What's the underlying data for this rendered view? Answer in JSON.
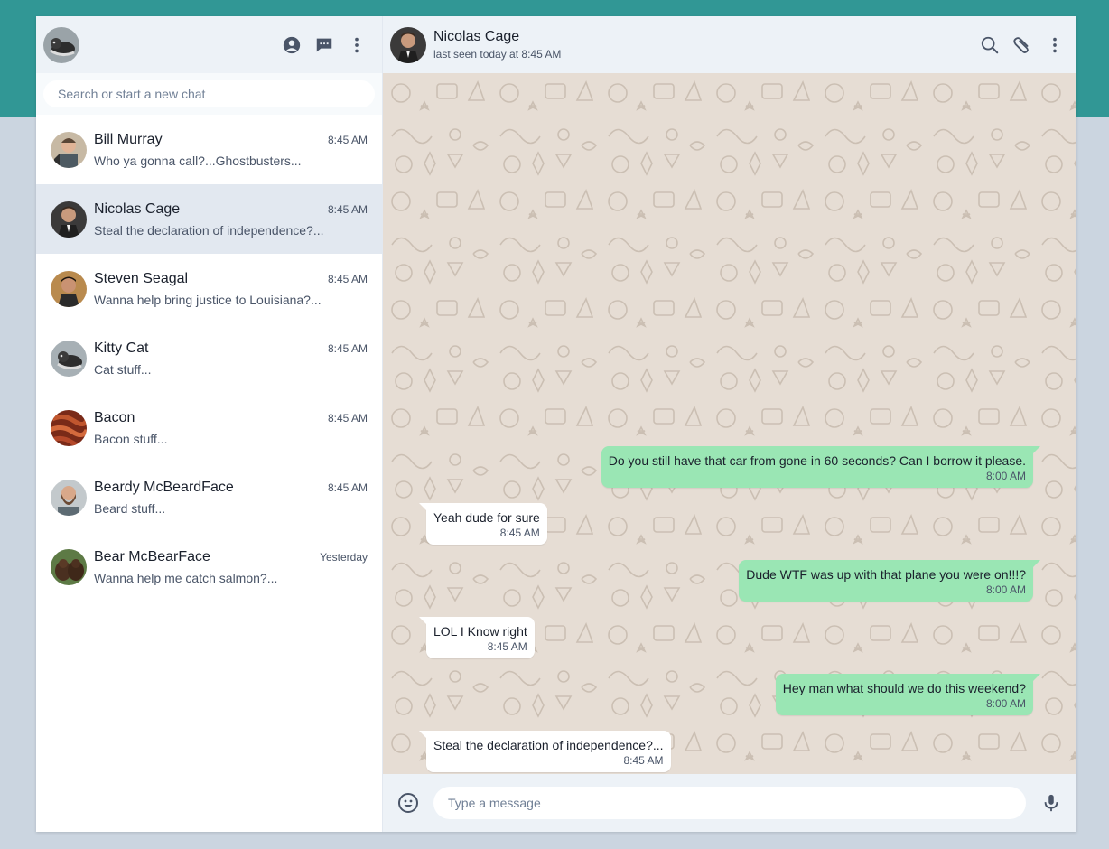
{
  "sidebar": {
    "search_placeholder": "Search or start a new chat",
    "icons": [
      "user-circle-icon",
      "chat-icon",
      "kebab-menu-icon"
    ],
    "chats": [
      {
        "name": "Bill Murray",
        "time": "8:45 AM",
        "preview": "Who ya gonna call?...Ghostbusters...",
        "active": false
      },
      {
        "name": "Nicolas Cage",
        "time": "8:45 AM",
        "preview": "Steal the declaration of independence?...",
        "active": true
      },
      {
        "name": "Steven Seagal",
        "time": "8:45 AM",
        "preview": "Wanna help bring justice to Louisiana?...",
        "active": false
      },
      {
        "name": "Kitty Cat",
        "time": "8:45 AM",
        "preview": "Cat stuff...",
        "active": false
      },
      {
        "name": "Bacon",
        "time": "8:45 AM",
        "preview": "Bacon stuff...",
        "active": false
      },
      {
        "name": "Beardy McBeardFace",
        "time": "8:45 AM",
        "preview": "Beard stuff...",
        "active": false
      },
      {
        "name": "Bear McBearFace",
        "time": "Yesterday",
        "preview": "Wanna help me catch salmon?...",
        "active": false
      }
    ]
  },
  "conversation": {
    "contact_name": "Nicolas Cage",
    "contact_status": "last seen today at 8:45 AM",
    "icons": [
      "search-icon",
      "paperclip-icon",
      "kebab-menu-icon"
    ],
    "messages": [
      {
        "direction": "out",
        "text": "Do you still have that car from gone in 60 seconds? Can I borrow it please.",
        "time": "8:00 AM"
      },
      {
        "direction": "in",
        "text": "Yeah dude for sure",
        "time": "8:45 AM"
      },
      {
        "direction": "out",
        "text": "Dude WTF was up with that plane you were on!!!?",
        "time": "8:00 AM"
      },
      {
        "direction": "in",
        "text": "LOL I Know right",
        "time": "8:45 AM"
      },
      {
        "direction": "out",
        "text": "Hey man what should we do this weekend?",
        "time": "8:00 AM"
      },
      {
        "direction": "in",
        "text": "Steal the declaration of independence?...",
        "time": "8:45 AM"
      }
    ]
  },
  "composer": {
    "placeholder": "Type a message",
    "icons": [
      "emoji-icon",
      "microphone-icon"
    ]
  },
  "colors": {
    "top_band": "#319795",
    "background": "#cbd5e0",
    "header": "#edf2f7",
    "active_chat": "#e2e8f0",
    "outgoing_bubble": "#9ae6b4",
    "incoming_bubble": "#ffffff",
    "wallpaper": "#e6ddd4"
  }
}
